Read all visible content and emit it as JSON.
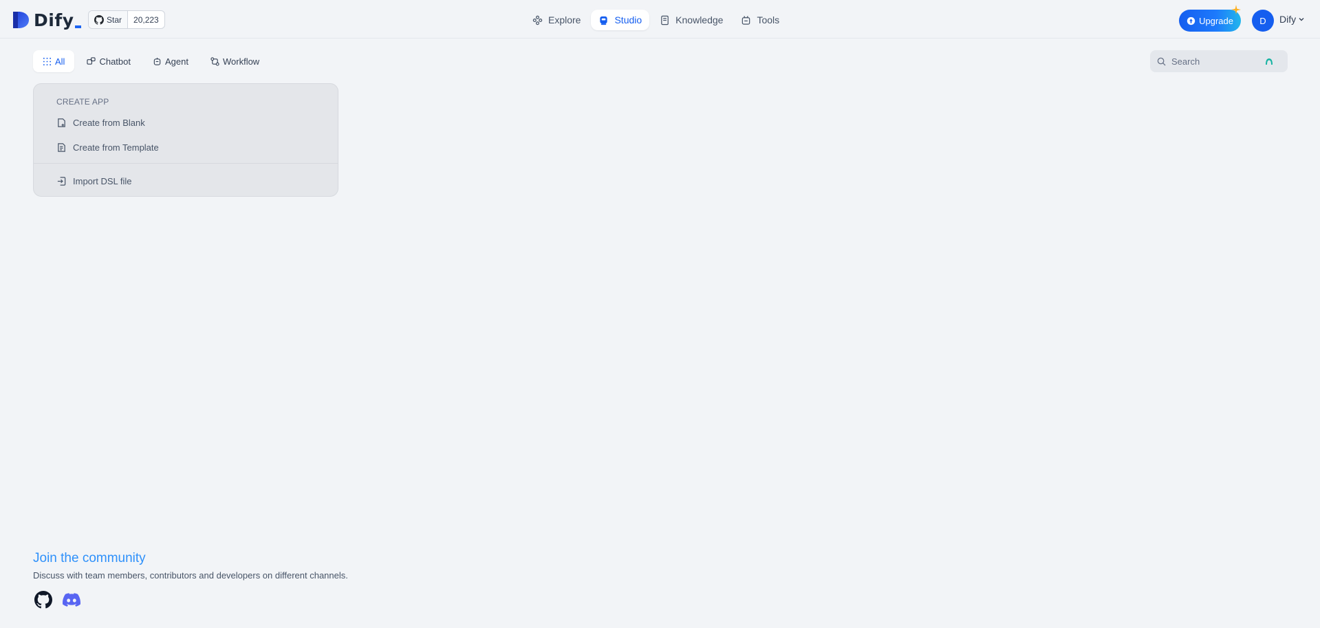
{
  "header": {
    "logo_text": "Dify",
    "github": {
      "star_label": "Star",
      "star_count": "20,223"
    },
    "nav": [
      {
        "label": "Explore",
        "icon": "explore-icon",
        "active": false
      },
      {
        "label": "Studio",
        "icon": "studio-robot-icon",
        "active": true
      },
      {
        "label": "Knowledge",
        "icon": "book-icon",
        "active": false
      },
      {
        "label": "Tools",
        "icon": "tools-icon",
        "active": false
      }
    ],
    "upgrade_label": "Upgrade",
    "avatar_initial": "D",
    "account_name": "Dify"
  },
  "tabs": [
    {
      "label": "All",
      "icon": "grid-icon",
      "active": true
    },
    {
      "label": "Chatbot",
      "icon": "chatbot-icon",
      "active": false
    },
    {
      "label": "Agent",
      "icon": "agent-icon",
      "active": false
    },
    {
      "label": "Workflow",
      "icon": "workflow-icon",
      "active": false
    }
  ],
  "search": {
    "placeholder": "Search"
  },
  "create_app": {
    "title": "CREATE APP",
    "items": [
      {
        "label": "Create from Blank",
        "icon": "file-plus-icon"
      },
      {
        "label": "Create from Template",
        "icon": "file-template-icon"
      },
      {
        "label": "Import DSL file",
        "icon": "import-icon"
      }
    ]
  },
  "community": {
    "title": "Join the community",
    "description": "Discuss with team members, contributors and developers on different channels.",
    "links": [
      {
        "icon": "github-icon"
      },
      {
        "icon": "discord-icon"
      }
    ]
  },
  "colors": {
    "accent": "#155eef",
    "background": "#f2f4f7",
    "community_title": "#2e90fa",
    "discord": "#5865f2"
  }
}
